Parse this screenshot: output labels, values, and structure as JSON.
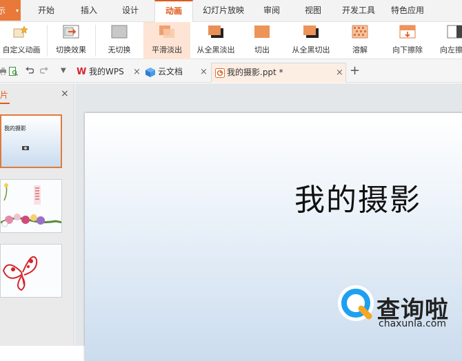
{
  "app_button": {
    "label": "示",
    "caret": "▾"
  },
  "menu_tabs": [
    "开始",
    "插入",
    "设计",
    "动画",
    "幻灯片放映",
    "审阅",
    "视图",
    "开发工具",
    "特色应用"
  ],
  "menu_active": "动画",
  "ribbon": {
    "custom_anim": "自定义动画",
    "items": [
      "切换效果",
      "无切换",
      "平滑淡出",
      "从全黑淡出",
      "切出",
      "从全黑切出",
      "溶解",
      "向下擦除",
      "向左擦"
    ],
    "selected": "平滑淡出"
  },
  "doc_tabs": [
    {
      "label": "我的WPS"
    },
    {
      "label": "云文档"
    },
    {
      "label": "我的摄影.ppt *"
    }
  ],
  "quick_access": {
    "dropdown": "▼",
    "add_tab": "+"
  },
  "left_panel": {
    "title": "片",
    "close": "×",
    "thumb1_title": "我的摄影"
  },
  "slide": {
    "title": "我的摄影"
  },
  "watermark": {
    "brand": "查询啦",
    "url": "chaxunla.com"
  },
  "colors": {
    "accent": "#e0591c",
    "selected_bg": "#fde4d4"
  }
}
